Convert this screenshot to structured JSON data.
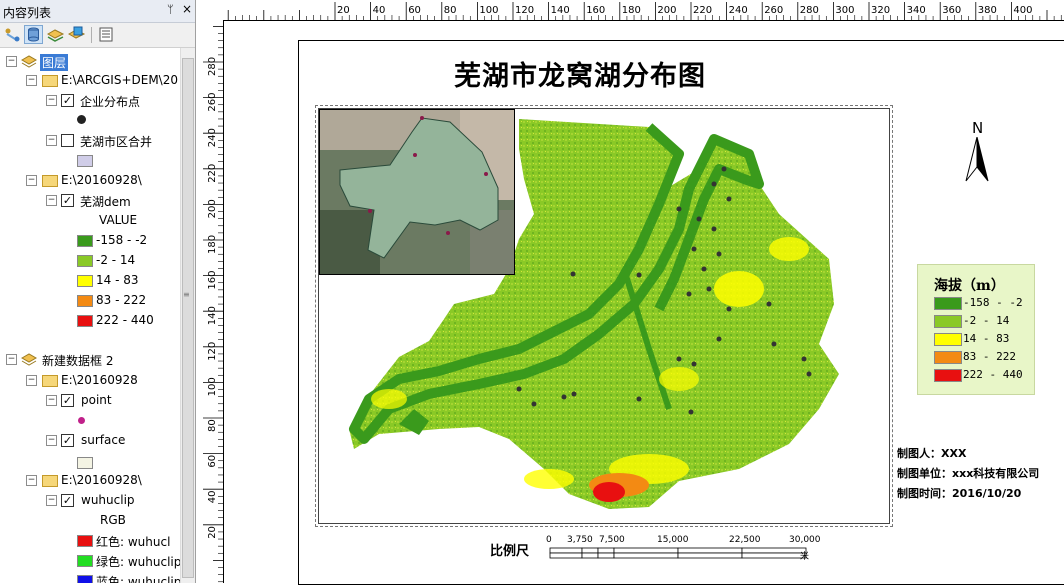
{
  "toc": {
    "title": "内容列表",
    "pin_glyph": "ᛘ",
    "close_glyph": "×",
    "layers_group": "图层",
    "gdb1_path": "E:\\ARCGIS+DEM\\20",
    "layer_points": "企业分布点",
    "layer_districts": "芜湖市区合并",
    "gdb2_path": "E:\\20160928\\",
    "layer_dem": "芜湖dem",
    "value_header": "VALUE",
    "classes": [
      {
        "label": "-158 - -2",
        "color": "#3a9a1c"
      },
      {
        "label": "-2 - 14",
        "color": "#8ac926"
      },
      {
        "label": "14 - 83",
        "color": "#ffff00"
      },
      {
        "label": "83 - 222",
        "color": "#f38a13"
      },
      {
        "label": "222 - 440",
        "color": "#e81010"
      }
    ],
    "frame2": "新建数据框 2",
    "gdb3_path": "E:\\20160928",
    "layer_point": "point",
    "layer_surface": "surface",
    "gdb4_path": "E:\\20160928\\",
    "layer_clip": "wuhuclip",
    "rgb_header": "RGB",
    "rgb": [
      {
        "label": "红色:    wuhucl",
        "color": "#e81010"
      },
      {
        "label": "绿色: wuhuclip",
        "color": "#22dd22"
      },
      {
        "label": "蓝色:    wuhuclip",
        "color": "#1010e8"
      }
    ]
  },
  "hruler_labels": [
    "20",
    "40",
    "60",
    "80",
    "100",
    "120",
    "140",
    "160",
    "180",
    "200",
    "220",
    "240",
    "260",
    "280",
    "300",
    "320",
    "340",
    "360",
    "380",
    "400"
  ],
  "vruler_labels": [
    "280",
    "260",
    "240",
    "220",
    "200",
    "180",
    "160",
    "140",
    "120",
    "100",
    "80",
    "60",
    "40",
    "20"
  ],
  "map": {
    "title": "芜湖市龙窝湖分布图",
    "north": "N",
    "legend_title": "海拔（m）",
    "legend_items": [
      {
        "label": "-158 - -2",
        "color": "#3a9a1c"
      },
      {
        "label": "-2 - 14",
        "color": "#8ac926"
      },
      {
        "label": "14 - 83",
        "color": "#ffff00"
      },
      {
        "label": "83 - 222",
        "color": "#f38a13"
      },
      {
        "label": "222 - 440",
        "color": "#e81010"
      }
    ],
    "author": "制图人：XXX",
    "unit": "制图单位：xxx科技有限公司",
    "date": "制图时间：2016/10/20",
    "scale_label": "比例尺",
    "scale_ticks": [
      "0",
      "3,750",
      "7,500",
      "15,000",
      "22,500",
      "30,000"
    ],
    "scale_unit": "米"
  }
}
